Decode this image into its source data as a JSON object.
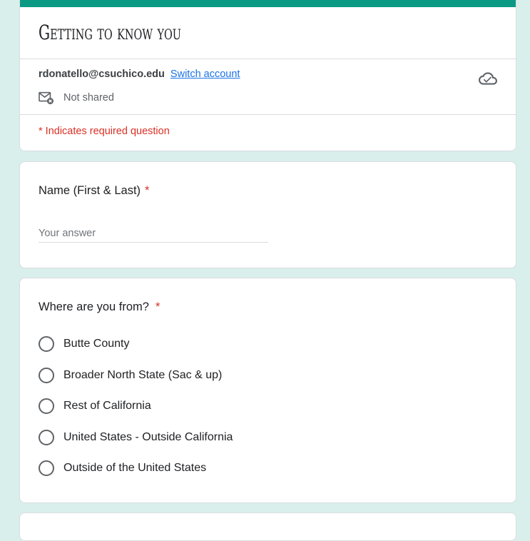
{
  "form": {
    "title": "Getting to know you",
    "account_email": "rdonatello@csuchico.edu",
    "switch_account_label": "Switch account",
    "shared_status": "Not shared",
    "required_note": "* Indicates required question",
    "accent_color": "#0a9a84",
    "background_color": "#d9efec"
  },
  "questions": [
    {
      "title": "Name (First & Last)",
      "required_marker": "*",
      "input_placeholder": "Your answer",
      "input_value": ""
    },
    {
      "title": "Where are you from?",
      "required_marker": "*",
      "options": [
        "Butte County",
        "Broader North State (Sac & up)",
        "Rest of California",
        "United States - Outside California",
        "Outside of the United States"
      ],
      "selected_option": null
    }
  ],
  "icons": {
    "cloud": "cloud-check-icon",
    "shared": "mail-not-shared-icon"
  }
}
